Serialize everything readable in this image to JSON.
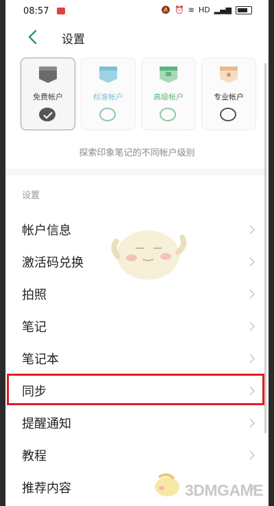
{
  "status_bar": {
    "time": "08:57",
    "network": "HD"
  },
  "header": {
    "title": "设置"
  },
  "plans": [
    {
      "label": "免费帐户",
      "selected": true,
      "color": "#666666"
    },
    {
      "label": "标准帐户",
      "selected": false,
      "color": "#7cc0d6"
    },
    {
      "label": "高级帐户",
      "selected": false,
      "color": "#5fb47f"
    },
    {
      "label": "专业帐户",
      "selected": false,
      "color": "#333333"
    }
  ],
  "explore_text": "探索印象笔记的不同帐户级别",
  "section_label": "设置",
  "menu": [
    {
      "label": "帐户信息"
    },
    {
      "label": "激活码兑换"
    },
    {
      "label": "拍照"
    },
    {
      "label": "笔记"
    },
    {
      "label": "笔记本"
    },
    {
      "label": "同步",
      "highlighted": true
    },
    {
      "label": "提醒通知"
    },
    {
      "label": "教程"
    },
    {
      "label": "推荐内容"
    }
  ],
  "watermark": "3DMGAME",
  "colors": {
    "accent": "#2b9b5f",
    "highlight": "#e01d24"
  }
}
